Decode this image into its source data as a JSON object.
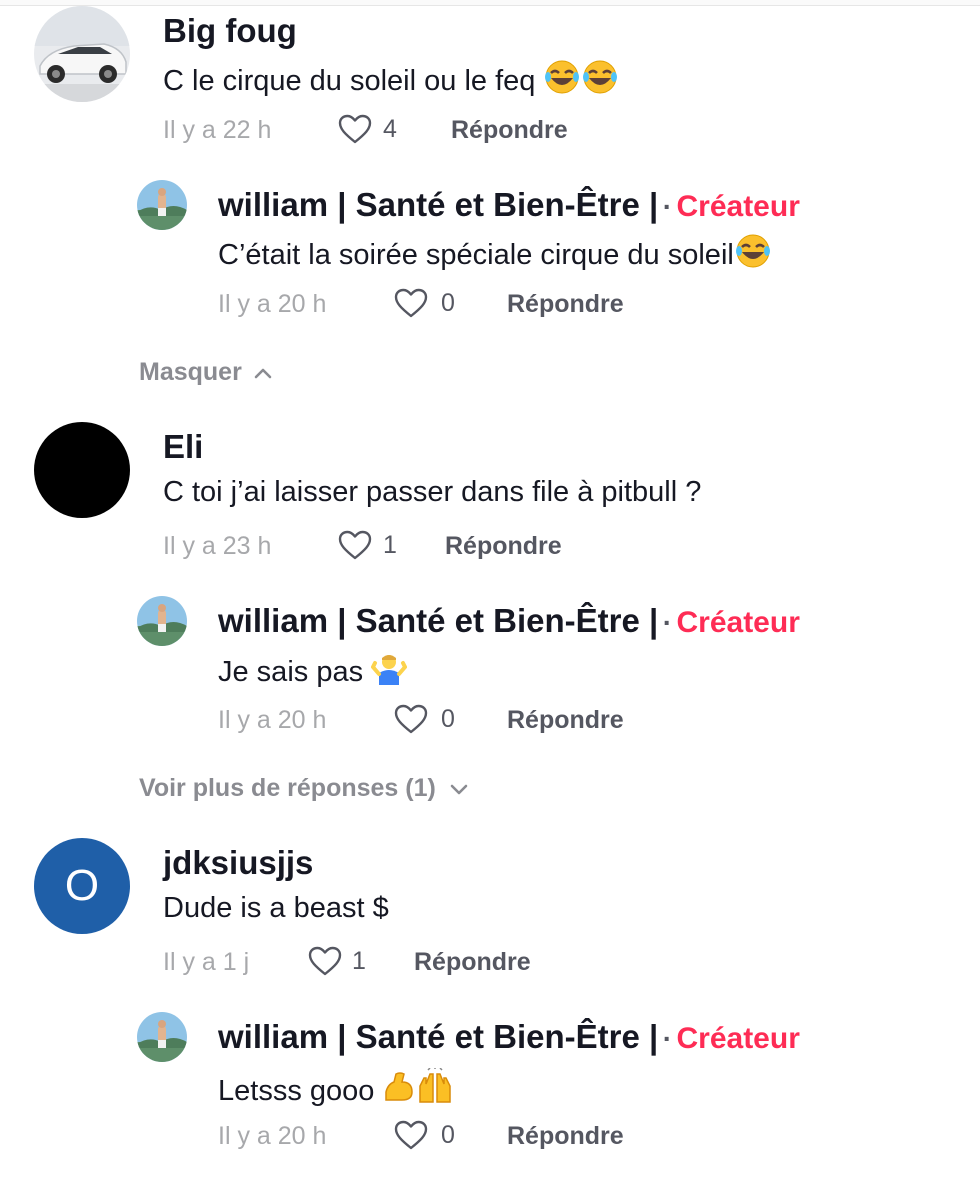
{
  "comments": [
    {
      "username": "Big foug",
      "text": "C le cirque du soleil ou le feq",
      "time": "Il y a 22 h",
      "likes": "4",
      "reply_label": "Répondre",
      "replies": [
        {
          "username": "william | Santé et Bien-Être |",
          "separator": "·",
          "badge": "Créateur",
          "text": "C’était la soirée spéciale cirque du soleil",
          "time": "Il y a 20 h",
          "likes": "0",
          "reply_label": "Répondre"
        }
      ],
      "toggle_label": "Masquer"
    },
    {
      "username": "Eli",
      "text": "C toi j’ai laisser passer dans file à pitbull ?",
      "time": "Il y a 23 h",
      "likes": "1",
      "reply_label": "Répondre",
      "replies": [
        {
          "username": "william | Santé et Bien-Être |",
          "separator": "·",
          "badge": "Créateur",
          "text": "Je sais pas",
          "time": "Il y a 20 h",
          "likes": "0",
          "reply_label": "Répondre"
        }
      ],
      "toggle_label": "Voir plus de réponses (1)"
    },
    {
      "username": "jdksiusjjs",
      "avatar_letter": "O",
      "text": "Dude is a beast $",
      "time": "Il y a 1 j",
      "likes": "1",
      "reply_label": "Répondre",
      "replies": [
        {
          "username": "william | Santé et Bien-Être |",
          "separator": "·",
          "badge": "Créateur",
          "text": "Letsss gooo",
          "time": "Il y a 20 h",
          "likes": "0",
          "reply_label": "Répondre"
        }
      ]
    }
  ],
  "colors": {
    "creator_badge": "#fe2c55",
    "avatar_letter_bg": "#1f5fa8",
    "muted_text": "#a7a8ab"
  }
}
